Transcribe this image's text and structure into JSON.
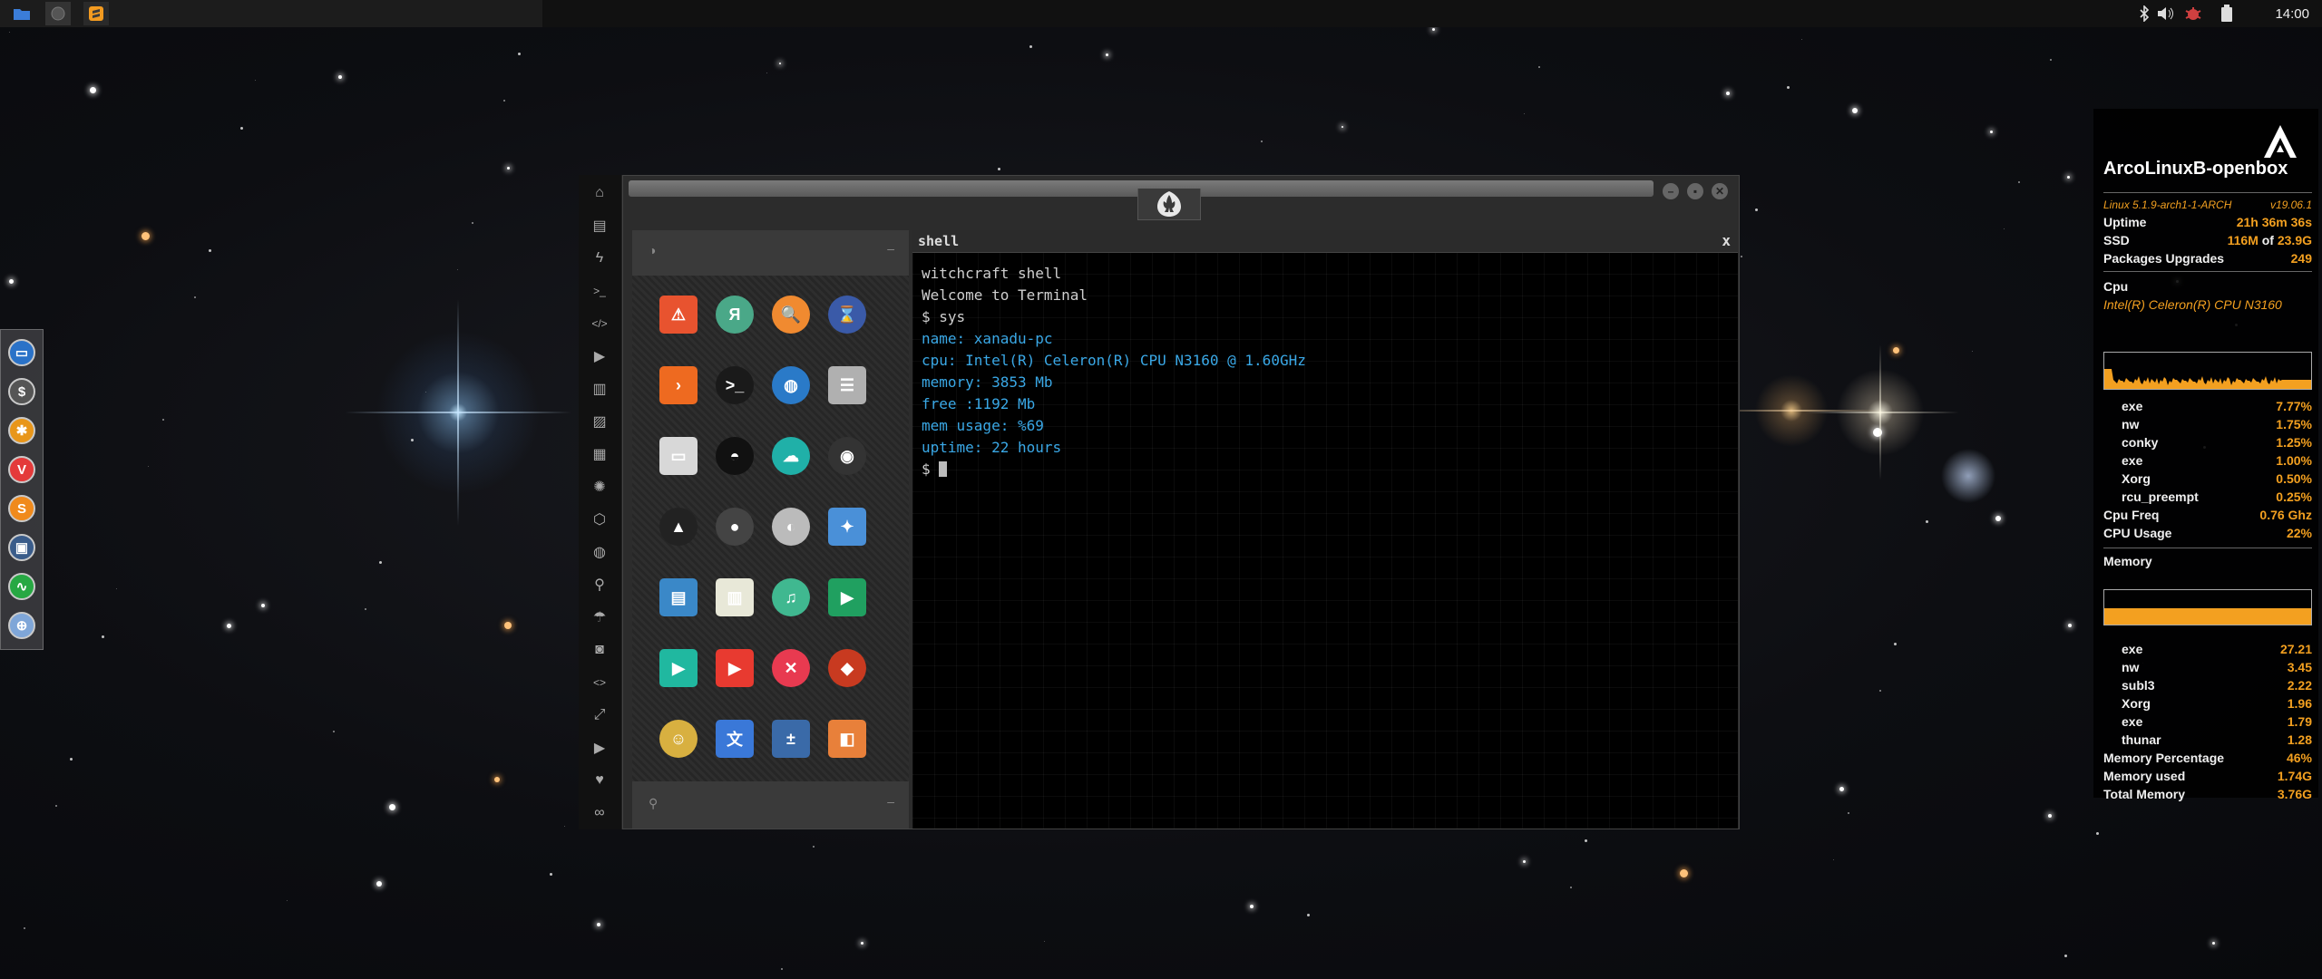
{
  "colors": {
    "accent": "#f3a020",
    "terminal_cyan": "#3aa8e6",
    "bg": "#0d0e12"
  },
  "topbar": {
    "tasks": [
      {
        "name": "file-manager",
        "icon": "folder-icon",
        "color": "#3b7dd8"
      },
      {
        "name": "app-placeholder",
        "icon": "circle-icon",
        "color": "#666"
      },
      {
        "name": "sublime-text",
        "icon": "sublime-icon",
        "color": "#f29a20"
      }
    ],
    "tray_icons": [
      "bluetooth-icon",
      "volume-icon",
      "bug-icon",
      "battery-icon"
    ],
    "clock": "14:00"
  },
  "dock": {
    "items": [
      {
        "name": "window-icon",
        "glyph": "▭",
        "color": "#2a72c8"
      },
      {
        "name": "money-icon",
        "glyph": "$",
        "color": "#555"
      },
      {
        "name": "gear-icon",
        "glyph": "✱",
        "color": "#e8961a"
      },
      {
        "name": "vivaldi-icon",
        "glyph": "V",
        "color": "#e43a3a"
      },
      {
        "name": "sublime-icon",
        "glyph": "S",
        "color": "#f08a1c"
      },
      {
        "name": "screen-icon",
        "glyph": "▣",
        "color": "#3a5c8a"
      },
      {
        "name": "pulse-icon",
        "glyph": "∿",
        "color": "#27a843"
      },
      {
        "name": "globe-icon",
        "glyph": "⊕",
        "color": "#7fa6d8"
      }
    ]
  },
  "launcher": {
    "icons": [
      "home-icon",
      "document-icon",
      "bolt-icon",
      "terminal-icon",
      "code-icon",
      "play-icon",
      "book-icon",
      "image-icon",
      "news-icon",
      "rebel-icon",
      "empire-icon",
      "globe-icon",
      "search-icon",
      "umbrella-icon",
      "user-icon",
      "code-brackets-icon",
      "expand-icon",
      "youtube-icon",
      "heart-icon",
      "infinity-icon"
    ]
  },
  "window": {
    "title": "",
    "logo": "rebel-alliance-icon"
  },
  "apps": {
    "grid": [
      [
        {
          "n": "warning",
          "g": "⚠",
          "c": "#e8532f"
        },
        {
          "n": "yandex",
          "g": "Я",
          "c": "#4aa888"
        },
        {
          "n": "search",
          "g": "🔍",
          "c": "#f08a30"
        },
        {
          "n": "hourglass",
          "g": "⌛",
          "c": "#3a5aa8"
        }
      ],
      [
        {
          "n": "arrow",
          "g": "›",
          "c": "#ee6a20"
        },
        {
          "n": "terminal",
          "g": ">_",
          "c": "#1a1a1a"
        },
        {
          "n": "globe",
          "g": "◍",
          "c": "#2a7ac8"
        },
        {
          "n": "database",
          "g": "☰",
          "c": "#b0b0b0"
        }
      ],
      [
        {
          "n": "window",
          "g": "▭",
          "c": "#d8d8d8"
        },
        {
          "n": "mask",
          "g": "◓",
          "c": "#111"
        },
        {
          "n": "cloud-lock",
          "g": "☁",
          "c": "#20b0a8"
        },
        {
          "n": "github",
          "g": "◉",
          "c": "#333"
        }
      ],
      [
        {
          "n": "starfleet",
          "g": "▲",
          "c": "#222"
        },
        {
          "n": "death-star",
          "g": "●",
          "c": "#444"
        },
        {
          "n": "moon",
          "g": "◐",
          "c": "#bbb"
        },
        {
          "n": "map",
          "g": "✦",
          "c": "#4a90d8"
        }
      ],
      [
        {
          "n": "archive",
          "g": "▤",
          "c": "#3a88c8"
        },
        {
          "n": "notes",
          "g": "▥",
          "c": "#e8e8d8"
        },
        {
          "n": "music",
          "g": "♫",
          "c": "#40b890"
        },
        {
          "n": "video",
          "g": "▶",
          "c": "#20a060"
        }
      ],
      [
        {
          "n": "player",
          "g": "▶",
          "c": "#20b8a0"
        },
        {
          "n": "youtube",
          "g": "▶",
          "c": "#e83a30"
        },
        {
          "n": "close",
          "g": "✕",
          "c": "#e83a50"
        },
        {
          "n": "ironman",
          "g": "◆",
          "c": "#c83a20"
        }
      ],
      [
        {
          "n": "c3po",
          "g": "☺",
          "c": "#d8b040"
        },
        {
          "n": "translate",
          "g": "文",
          "c": "#3a78d8"
        },
        {
          "n": "calculator",
          "g": "±",
          "c": "#3a6aa8"
        },
        {
          "n": "photos",
          "g": "◧",
          "c": "#e8803a"
        }
      ]
    ]
  },
  "terminal": {
    "title": "shell",
    "close": "x",
    "lines": [
      {
        "text": "witchcraft shell",
        "style": "white"
      },
      {
        "text": "Welcome to Terminal",
        "style": "white"
      },
      {
        "text": "$ sys",
        "style": "white"
      },
      {
        "text": "name: xanadu-pc",
        "style": "cyan"
      },
      {
        "text": "cpu: Intel(R) Celeron(R) CPU N3160 @ 1.60GHz",
        "style": "cyan"
      },
      {
        "text": "memory: 3853 Mb",
        "style": "cyan"
      },
      {
        "text": "free :1192 Mb",
        "style": "cyan"
      },
      {
        "text": "mem usage: %69",
        "style": "cyan"
      },
      {
        "text": "uptime: 22 hours",
        "style": "cyan"
      }
    ],
    "prompt": "$ "
  },
  "conky": {
    "logo": "arcolinux-icon",
    "host": "ArcoLinuxB-openbox",
    "kernel": "Linux 5.1.9-arch1-1-ARCH",
    "version": "v19.06.1",
    "uptime_label": "Uptime",
    "uptime": "21h 36m 36s",
    "ssd_label": "SSD",
    "ssd_used": "116M",
    "ssd_of": "of",
    "ssd_total": "23.9G",
    "pkg_label": "Packages Upgrades",
    "pkg": "249",
    "cpu_label": "Cpu",
    "cpu_model": "Intel(R) Celeron(R) CPU  N3160",
    "cpu_procs": [
      {
        "name": "exe",
        "val": "7.77%"
      },
      {
        "name": "nw",
        "val": "1.75%"
      },
      {
        "name": "conky",
        "val": "1.25%"
      },
      {
        "name": "exe",
        "val": "1.00%"
      },
      {
        "name": "Xorg",
        "val": "0.50%"
      },
      {
        "name": "rcu_preempt",
        "val": "0.25%"
      }
    ],
    "cpu_freq_label": "Cpu Freq",
    "cpu_freq": "0.76 Ghz",
    "cpu_usage_label": "CPU Usage",
    "cpu_usage": "22%",
    "cpu_usage_fraction": 0.22,
    "mem_label": "Memory",
    "mem_fraction": 0.46,
    "mem_procs": [
      {
        "name": "exe",
        "val": "27.21"
      },
      {
        "name": "nw",
        "val": "3.45"
      },
      {
        "name": "subl3",
        "val": "2.22"
      },
      {
        "name": "Xorg",
        "val": "1.96"
      },
      {
        "name": "exe",
        "val": "1.79"
      },
      {
        "name": "thunar",
        "val": "1.28"
      }
    ],
    "mem_pct_label": "Memory Percentage",
    "mem_pct": "46%",
    "mem_used_label": "Memory used",
    "mem_used": "1.74G",
    "mem_total_label": "Total Memory",
    "mem_total": "3.76G"
  }
}
